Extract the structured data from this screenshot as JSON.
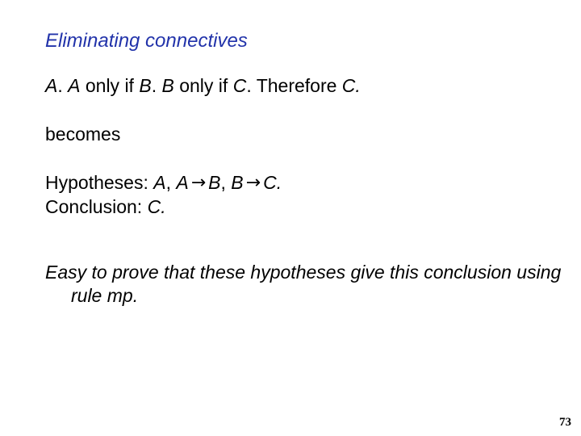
{
  "slide": {
    "title": "Eliminating connectives",
    "title_color": "#2233aa",
    "background_color": "#ffffff",
    "text_color": "#000000",
    "page_number": "73"
  },
  "content": {
    "statement": {
      "var_a1": "A",
      "sep1": ". ",
      "var_a2": "A",
      "only_if_1": " only if ",
      "var_b1": "B",
      "sep2": ". ",
      "var_b2": "B",
      "only_if_2": " only if ",
      "var_c1": "C",
      "sep3": ". ",
      "therefore": "Therefore ",
      "var_c2": "C",
      "period": ".",
      "plain": "A. A only if B. B only if C. Therefore C."
    },
    "becomes_label": "becomes",
    "hypotheses": {
      "label": "Hypotheses: ",
      "h1": "A",
      "comma1": ", ",
      "h2a": "A",
      "arrow1": "→",
      "h2b": "B",
      "comma2": ", ",
      "h3a": "B",
      "arrow2": "→",
      "h3b": "C",
      "period": ".",
      "plain": "Hypotheses: A, A → B, B → C."
    },
    "conclusion": {
      "label": "Conclusion: ",
      "value": "C",
      "period": ".",
      "plain": "Conclusion: C."
    },
    "note": "Easy to prove that these hypotheses give this conclusion using rule mp."
  }
}
